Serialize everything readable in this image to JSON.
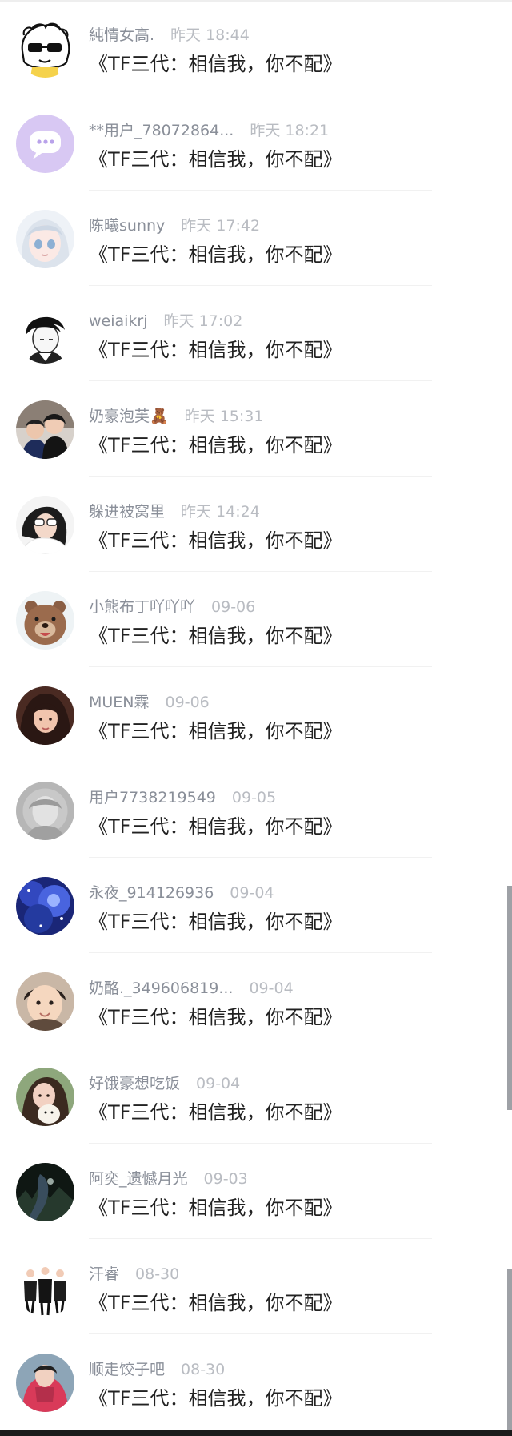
{
  "comments": [
    {
      "name": "純情女高.",
      "time": "昨天 18:44",
      "message": "《TF三代：相信我，你不配》",
      "avatar_icon": "cartoon-sunglasses-avatar-icon"
    },
    {
      "name": "**用户_78072864...",
      "time": "昨天 18:21",
      "message": "《TF三代：相信我，你不配》",
      "avatar_icon": "purple-chat-avatar-icon"
    },
    {
      "name": "陈曦sunny",
      "time": "昨天 17:42",
      "message": "《TF三代：相信我，你不配》",
      "avatar_icon": "anime-girl-avatar-icon"
    },
    {
      "name": "weiaikrj",
      "time": "昨天 17:02",
      "message": "《TF三代：相信我，你不配》",
      "avatar_icon": "sketch-boy-avatar-icon"
    },
    {
      "name": "奶豪泡芙🧸",
      "time": "昨天 15:31",
      "message": "《TF三代：相信我，你不配》",
      "avatar_icon": "photo-friends-avatar-icon"
    },
    {
      "name": "躲进被窝里",
      "time": "昨天 14:24",
      "message": "《TF三代：相信我，你不配》",
      "avatar_icon": "photo-girl-avatar-icon"
    },
    {
      "name": "小熊布丁吖吖吖",
      "time": "09-06",
      "message": "《TF三代：相信我，你不配》",
      "avatar_icon": "brown-bear-avatar-icon"
    },
    {
      "name": "MUEN霖",
      "time": "09-06",
      "message": "《TF三代：相信我，你不配》",
      "avatar_icon": "portrait-girl-avatar-icon"
    },
    {
      "name": "用户7738219549",
      "time": "09-05",
      "message": "《TF三代：相信我，你不配》",
      "avatar_icon": "gray-default-avatar-icon"
    },
    {
      "name": "永夜_914126936",
      "time": "09-04",
      "message": "《TF三代：相信我，你不配》",
      "avatar_icon": "blue-galaxy-avatar-icon"
    },
    {
      "name": "奶酪._349606819...",
      "time": "09-04",
      "message": "《TF三代：相信我，你不配》",
      "avatar_icon": "baby-avatar-icon"
    },
    {
      "name": "好饿豪想吃饭",
      "time": "09-04",
      "message": "《TF三代：相信我，你不配》",
      "avatar_icon": "girl-dog-avatar-icon"
    },
    {
      "name": "阿奕_遗憾月光",
      "time": "09-03",
      "message": "《TF三代：相信我，你不配》",
      "avatar_icon": "dark-forest-avatar-icon"
    },
    {
      "name": "汗睿",
      "time": "08-30",
      "message": "《TF三代：相信我，你不配》",
      "avatar_icon": "three-boys-avatar-icon"
    },
    {
      "name": "顺走饺子吧",
      "time": "08-30",
      "message": "《TF三代：相信我，你不配》",
      "avatar_icon": "red-hoodie-avatar-icon"
    }
  ],
  "colors": {
    "name": "#8a8f99",
    "time": "#b9bcc2",
    "message": "#222222",
    "separator": "#f1f1f1",
    "scrollbar": "#9ea1a6"
  }
}
